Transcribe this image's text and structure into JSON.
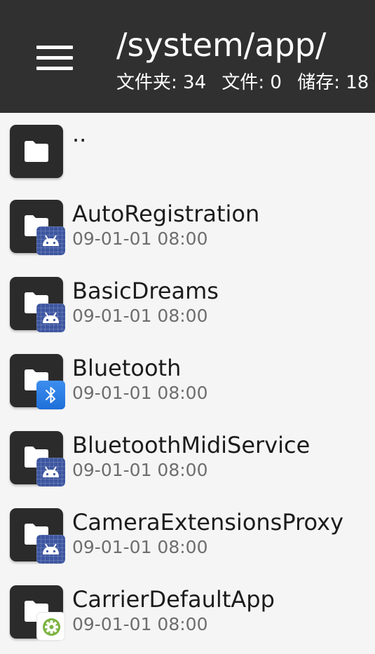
{
  "header": {
    "path": "/system/app/",
    "stats": {
      "folders": "文件夹: 34",
      "files": "文件: 0",
      "storage": "储存: 18"
    }
  },
  "items": [
    {
      "name": "..",
      "date": "",
      "badge": ""
    },
    {
      "name": "AutoRegistration",
      "date": "09-01-01 08:00",
      "badge": "android-icon"
    },
    {
      "name": "BasicDreams",
      "date": "09-01-01 08:00",
      "badge": "android-icon"
    },
    {
      "name": "Bluetooth",
      "date": "09-01-01 08:00",
      "badge": "bluetooth-icon"
    },
    {
      "name": "BluetoothMidiService",
      "date": "09-01-01 08:00",
      "badge": "android-icon"
    },
    {
      "name": "CameraExtensionsProxy",
      "date": "09-01-01 08:00",
      "badge": "android-icon"
    },
    {
      "name": "CarrierDefaultApp",
      "date": "09-01-01 08:00",
      "badge": "settings-gear-icon"
    }
  ],
  "colors": {
    "header_bg": "#303030",
    "list_bg": "#f5f5f5",
    "folder_tile": "#2b2b2b",
    "android_badge": "#3d56a0",
    "bluetooth_badge": "#1f6fd9",
    "settings_badge": "#7cb342"
  }
}
